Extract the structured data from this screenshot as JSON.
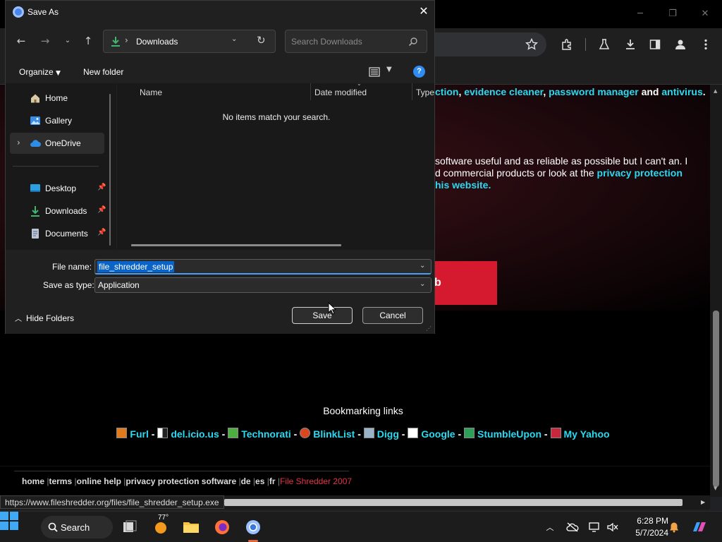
{
  "dialog": {
    "title": "Save As",
    "path": "Downloads",
    "search_placeholder": "Search Downloads",
    "commands": {
      "organize": "Organize",
      "new_folder": "New folder"
    },
    "nav": {
      "home": "Home",
      "gallery": "Gallery",
      "onedrive": "OneDrive",
      "desktop": "Desktop",
      "downloads": "Downloads",
      "documents": "Documents"
    },
    "columns": {
      "name": "Name",
      "date_modified": "Date modified",
      "type": "Type"
    },
    "empty_message": "No items match your search.",
    "file_name_label": "File name:",
    "file_name_value": "file_shredder_setup",
    "save_as_type_label": "Save as type:",
    "save_as_type_value": "Application",
    "hide_folders": "Hide Folders",
    "save_button": "Save",
    "cancel_button": "Cancel"
  },
  "webpage": {
    "line1": {
      "frag1": "ction",
      "sep1": ", ",
      "link1": "evidence cleaner",
      "sep2": ", ",
      "link2": "password manager",
      "sep3": " and ",
      "link3": "antivirus",
      "end": "."
    },
    "line2": "software useful and as reliable as possible but I can't an. I",
    "line3": {
      "text": "d commercial products or look at the ",
      "link": "privacy protection"
    },
    "line4": "his website.",
    "red_button": "b",
    "bookmarking_title": "Bookmarking links",
    "bookmarks": [
      "Furl",
      "del.icio.us",
      "Technorati",
      "BlinkList",
      "Digg",
      "Google",
      "StumbleUpon",
      "My Yahoo"
    ],
    "bookmark_sep": " - ",
    "footer": {
      "links": [
        "home",
        "terms",
        "online help",
        "privacy protection software",
        "de",
        "es",
        "fr"
      ],
      "sep": " |",
      "copyright": "File Shredder 2007"
    },
    "status_url": "https://www.fileshredder.org/files/file_shredder_setup.exe"
  },
  "taskbar": {
    "search_label": "Search",
    "weather_temp": "77°",
    "time": "6:28 PM",
    "date": "5/7/2024"
  },
  "colors": {
    "accent_blue": "#0a64c8",
    "link_cyan": "#2bd9f0",
    "web_red": "#d51a2f",
    "footer_red": "#e0344a"
  }
}
